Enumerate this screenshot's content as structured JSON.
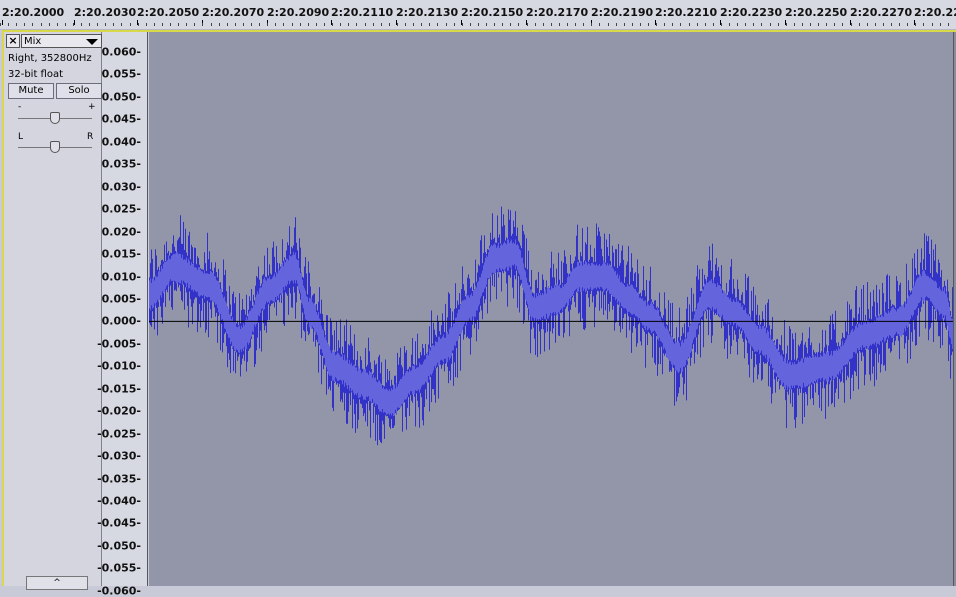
{
  "ruler": {
    "labels": [
      "2:20.2000",
      "2:20.2030",
      "2:20.2050",
      "2:20.2070",
      "2:20.2090",
      "2:20.2110",
      "2:20.2130",
      "2:20.2150",
      "2:20.2170",
      "2:20.2190",
      "2:20.2210",
      "2:20.2230",
      "2:20.2250",
      "2:20.2270",
      "2:20.22"
    ]
  },
  "track": {
    "name": "Mix",
    "channel_info": "Right, 352800Hz",
    "format": "32-bit float",
    "mute_label": "Mute",
    "solo_label": "Solo",
    "gain_minus": "-",
    "gain_plus": "+",
    "pan_left": "L",
    "pan_right": "R",
    "gain_level": 0.5,
    "pan_level": 0.5
  },
  "amplitude_axis": {
    "labels": [
      "0.060-",
      "0.055-",
      "0.050-",
      "0.045-",
      "0.040-",
      "0.035-",
      "0.030-",
      "0.025-",
      "0.020-",
      "0.015-",
      "0.010-",
      "0.005-",
      "0.000-",
      "-0.005-",
      "-0.010-",
      "-0.015-",
      "-0.020-",
      "-0.025-",
      "-0.030-",
      "-0.035-",
      "-0.040-",
      "-0.045-",
      "-0.050-",
      "-0.055-",
      "-0.060-"
    ]
  },
  "colors": {
    "wave_dark": "#3232c8",
    "wave_light": "#6464dc",
    "background": "#9396a9",
    "selection_border": "#d8d84a"
  },
  "icons": {
    "close": "close-icon",
    "dropdown": "chevron-down-icon",
    "scroll": "chevron-up-icon"
  }
}
